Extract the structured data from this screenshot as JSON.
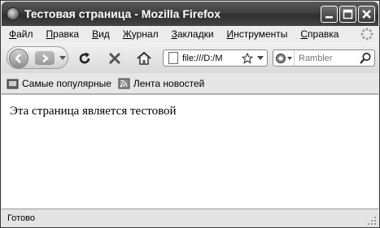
{
  "window": {
    "title": "Тестовая страница - Mozilla Firefox"
  },
  "menu": [
    {
      "u": "Ф",
      "rest": "айл"
    },
    {
      "u": "П",
      "rest": "равка"
    },
    {
      "u": "В",
      "rest": "ид"
    },
    {
      "u": "Ж",
      "rest": "урнал"
    },
    {
      "u": "З",
      "rest": "акладки"
    },
    {
      "u": "И",
      "rest": "нструменты"
    },
    {
      "u": "С",
      "rest": "правка"
    }
  ],
  "navbar": {
    "url_value": "file:///D:/M",
    "search_placeholder": "Rambler"
  },
  "bookmarks": {
    "most_visited": "Самые популярные",
    "news_feed": "Лента новостей"
  },
  "content": {
    "text": "Эта страница является тестовой"
  },
  "status": {
    "text": "Готово"
  },
  "icons": {
    "back": "back-arrow-icon",
    "forward": "forward-arrow-icon",
    "reload": "reload-icon",
    "stop": "stop-icon",
    "home": "home-icon",
    "bookmark_star": "star-icon",
    "rss": "rss-icon",
    "search_go": "magnifier-icon"
  }
}
